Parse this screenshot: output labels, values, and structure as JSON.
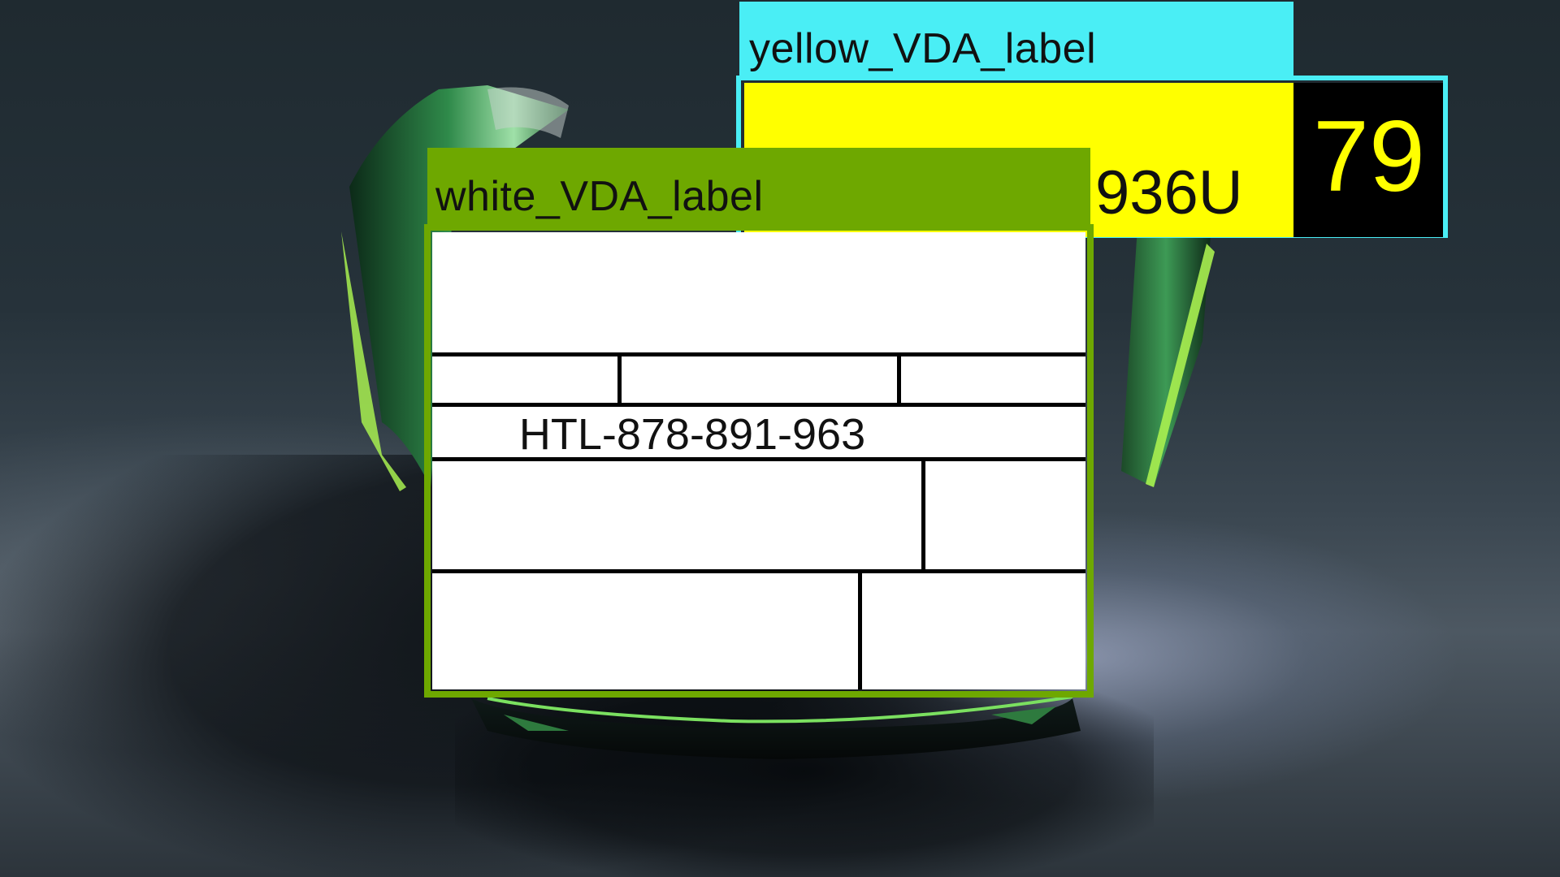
{
  "yellow_label": {
    "tag": "yellow_VDA_label",
    "partial_code": "936U",
    "number": "79",
    "colors": {
      "tag": "#4aeef5",
      "body": "#ffff00",
      "number_bg": "#000000",
      "number_fg": "#ffff00"
    }
  },
  "white_label": {
    "tag": "white_VDA_label",
    "code": "HTL-878-891-963",
    "colors": {
      "tag": "#6ea800",
      "body": "#ffffff"
    }
  }
}
